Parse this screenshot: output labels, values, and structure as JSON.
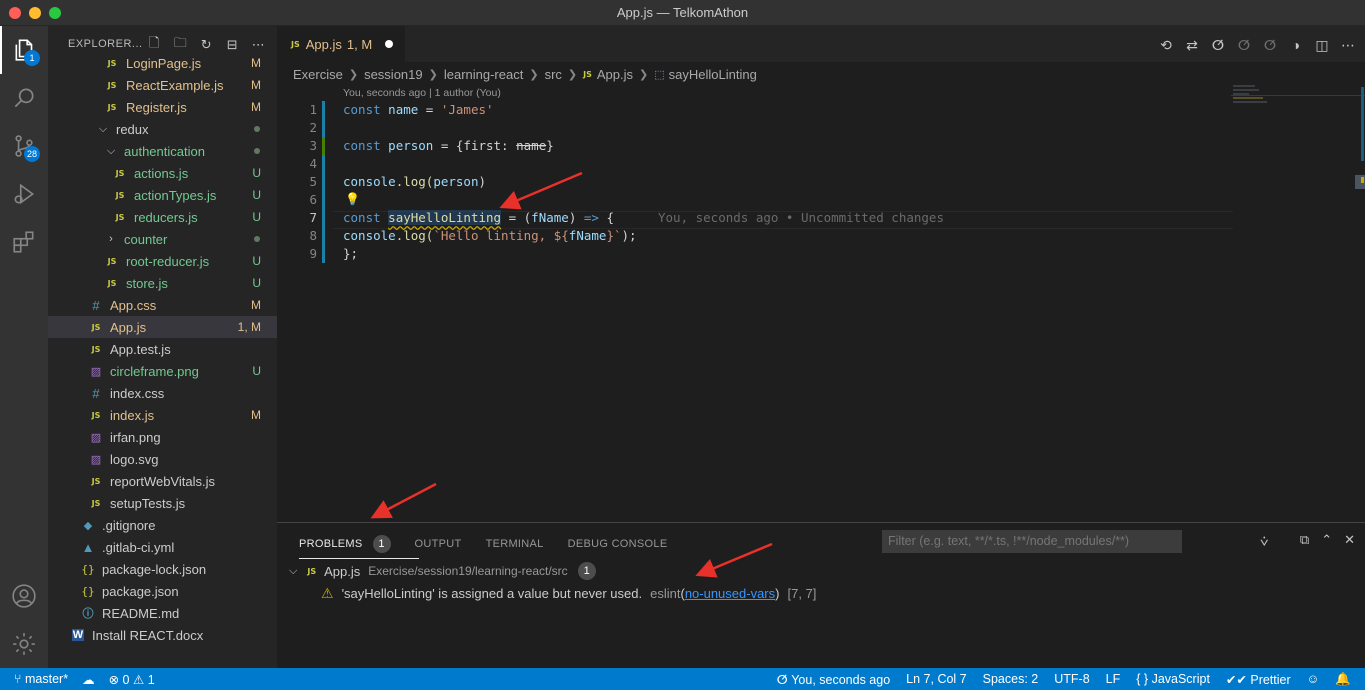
{
  "window": {
    "title": "App.js — TelkomAthon"
  },
  "activity": {
    "explorer_badge": "1",
    "scm_badge": "28"
  },
  "explorer": {
    "title": "EXPLORER...",
    "items": [
      {
        "name": "LoginPage.js",
        "type": "js",
        "status": "M",
        "color": "mod"
      },
      {
        "name": "ReactExample.js",
        "type": "js",
        "status": "M",
        "color": "mod"
      },
      {
        "name": "Register.js",
        "type": "js",
        "status": "M",
        "color": "mod"
      },
      {
        "name": "redux",
        "type": "folder-open",
        "status": "",
        "color": "plain"
      },
      {
        "name": "authentication",
        "type": "folder-open",
        "status": "",
        "color": "unt"
      },
      {
        "name": "actions.js",
        "type": "js",
        "status": "U",
        "color": "unt"
      },
      {
        "name": "actionTypes.js",
        "type": "js",
        "status": "U",
        "color": "unt"
      },
      {
        "name": "reducers.js",
        "type": "js",
        "status": "U",
        "color": "unt"
      },
      {
        "name": "counter",
        "type": "folder-closed",
        "status": "",
        "color": "unt"
      },
      {
        "name": "root-reducer.js",
        "type": "js",
        "status": "U",
        "color": "unt"
      },
      {
        "name": "store.js",
        "type": "js",
        "status": "U",
        "color": "unt"
      },
      {
        "name": "App.css",
        "type": "css",
        "status": "M",
        "color": "mod"
      },
      {
        "name": "App.js",
        "type": "js",
        "status": "1, M",
        "color": "mod"
      },
      {
        "name": "App.test.js",
        "type": "js",
        "status": "",
        "color": "plain"
      },
      {
        "name": "circleframe.png",
        "type": "img",
        "status": "U",
        "color": "unt"
      },
      {
        "name": "index.css",
        "type": "css",
        "status": "",
        "color": "plain"
      },
      {
        "name": "index.js",
        "type": "js",
        "status": "M",
        "color": "mod"
      },
      {
        "name": "irfan.png",
        "type": "img",
        "status": "",
        "color": "plain"
      },
      {
        "name": "logo.svg",
        "type": "img",
        "status": "",
        "color": "plain"
      },
      {
        "name": "reportWebVitals.js",
        "type": "js",
        "status": "",
        "color": "plain"
      },
      {
        "name": "setupTests.js",
        "type": "js",
        "status": "",
        "color": "plain"
      },
      {
        "name": ".gitignore",
        "type": "git",
        "status": "",
        "color": "plain"
      },
      {
        "name": ".gitlab-ci.yml",
        "type": "gitlab",
        "status": "",
        "color": "plain"
      },
      {
        "name": "package-lock.json",
        "type": "json",
        "status": "",
        "color": "plain"
      },
      {
        "name": "package.json",
        "type": "json",
        "status": "",
        "color": "plain"
      },
      {
        "name": "README.md",
        "type": "info",
        "status": "",
        "color": "plain"
      },
      {
        "name": "Install REACT.docx",
        "type": "docx",
        "status": "",
        "color": "plain"
      }
    ]
  },
  "tab": {
    "icon": "JS",
    "name": "App.js",
    "count": "1, M"
  },
  "breadcrumb": [
    "Exercise",
    "session19",
    "learning-react",
    "src",
    "App.js",
    "sayHelloLinting"
  ],
  "editor": {
    "codelens": "You, seconds ago | 1 author (You)",
    "line_numbers": [
      "1",
      "2",
      "3",
      "4",
      "5",
      "6",
      "7",
      "8",
      "9"
    ],
    "blame": "You, seconds ago • Uncommitted changes",
    "tokens": {
      "const": "const",
      "name": "name",
      "eq": " = ",
      "james": "'James'",
      "person": "person",
      "brace_open": " = {first: ",
      "brace_close": "}",
      "console": "console",
      "dot_log": ".log(",
      "close_paren": ")",
      "say": "sayHelloLinting",
      "param_open": " = (",
      "fname": "fName",
      "param_close": ") ",
      "arrow": "=>",
      "body_open": " {",
      "tpl_open": "`Hello linting, ${",
      "tpl_close": "}`",
      "semi": ");",
      "end": "};"
    }
  },
  "panel": {
    "tabs": [
      "PROBLEMS",
      "OUTPUT",
      "TERMINAL",
      "DEBUG CONSOLE"
    ],
    "problems_count": "1",
    "filter_placeholder": "Filter (e.g. text, **/*.ts, !**/node_modules/**)",
    "file": "App.js",
    "path": "Exercise/session19/learning-react/src",
    "file_count": "1",
    "message": "'sayHelloLinting' is assigned a value but never used.",
    "source": "eslint",
    "rule": "no-unused-vars",
    "location": "[7, 7]"
  },
  "status": {
    "branch": "master*",
    "errors": "0",
    "warnings": "1",
    "blame": "You, seconds ago",
    "position": "Ln 7, Col 7",
    "spaces": "Spaces: 2",
    "encoding": "UTF-8",
    "eol": "LF",
    "language": "JavaScript",
    "formatter": "Prettier"
  },
  "colors": {
    "accent": "#007acc",
    "modified": "#e2c08d",
    "untracked": "#73c991",
    "annotation": "#e8312a"
  }
}
